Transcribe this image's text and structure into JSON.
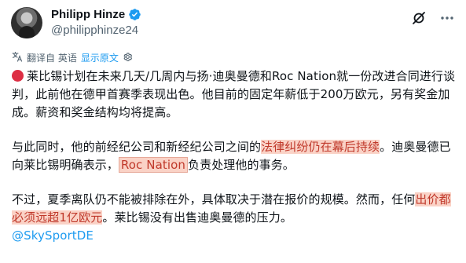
{
  "author": {
    "name": "Philipp Hinze",
    "handle": "@philipphinze24"
  },
  "translation": {
    "label": "翻译自 英语",
    "show_original": "显示原文"
  },
  "icons": {
    "verified": "verified-badge-icon",
    "grok": "grok-icon",
    "more": "more-options-icon",
    "translate": "translate-icon",
    "settings": "gear-icon",
    "status": "red-circle-icon"
  },
  "colors": {
    "accent": "#1d9bf0",
    "highlight_bg": "#fad2c6",
    "highlight_text": "#c0392b",
    "status_dot": "#dd2e44"
  },
  "tweet": {
    "p1": "莱比锡计划在未来几天/几周内与扬·迪奥曼德和Roc Nation就一份改进合同进行谈判，此前他在德甲首赛季表现出色。他目前的固定年薪低于200万欧元，另有奖金加成。薪资和奖金结构均将提高。",
    "p2_a": "与此同时，他的前经纪公司和新经纪公司之间的",
    "p2_hl1": "法律纠纷仍在幕后持续",
    "p2_b": "。迪奥曼德已向莱比锡明确表示，",
    "p2_hl2": "Roc Nation",
    "p2_c": "负责处理他的事务。",
    "p3_a": "不过，夏季离队仍不能被排除在外，具体取决于潜在报价的规模。然而，任何",
    "p3_hl": "出价都必须远超1亿欧元",
    "p3_b": "。莱比锡没有出售迪奥曼德的压力。",
    "mention": "@SkySportDE"
  }
}
